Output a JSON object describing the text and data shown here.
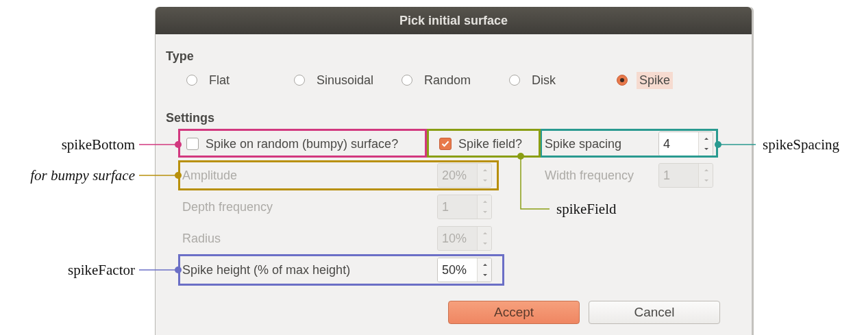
{
  "window": {
    "title": "Pick initial surface"
  },
  "type_group": {
    "heading": "Type",
    "options": [
      {
        "label": "Flat",
        "selected": false,
        "focused": false
      },
      {
        "label": "Sinusoidal",
        "selected": false,
        "focused": false
      },
      {
        "label": "Random",
        "selected": false,
        "focused": false
      },
      {
        "label": "Disk",
        "selected": false,
        "focused": false
      },
      {
        "label": "Spike",
        "selected": true,
        "focused": true
      }
    ]
  },
  "settings": {
    "heading": "Settings",
    "rows": [
      {
        "items": [
          {
            "kind": "checkbox",
            "label": "Spike on random (bumpy) surface?",
            "checked": false
          },
          {
            "kind": "checkbox",
            "label": "Spike field?",
            "checked": true
          },
          {
            "kind": "spinner",
            "label": "Spike spacing",
            "value": "4",
            "disabled": false
          }
        ]
      },
      {
        "items": [
          {
            "kind": "spinner",
            "label": "Amplitude",
            "value": "20%",
            "disabled": true
          },
          {
            "kind": "spinner",
            "label": "Width frequency",
            "value": "1",
            "disabled": true
          }
        ]
      },
      {
        "items": [
          {
            "kind": "spinner",
            "label": "Depth frequency",
            "value": "1",
            "disabled": true
          }
        ]
      },
      {
        "items": [
          {
            "kind": "spinner",
            "label": "Radius",
            "value": "10%",
            "disabled": true
          }
        ]
      },
      {
        "items": [
          {
            "kind": "spinner",
            "label": "Spike height (% of max height)",
            "value": "50%",
            "disabled": false
          }
        ]
      }
    ]
  },
  "buttons": [
    {
      "label": "Accept",
      "kind": "primary"
    },
    {
      "label": "Cancel",
      "kind": "secondary"
    }
  ],
  "annotations": [
    {
      "label": "spikeBottom",
      "kind": "name",
      "color": "#d2387f"
    },
    {
      "label": "spikeSpacing",
      "kind": "name",
      "color": "#2a9a90"
    },
    {
      "label": "for bumpy surface",
      "kind": "note",
      "color": "#b8900c"
    },
    {
      "label": "spikeField",
      "kind": "name",
      "color": "#8a9e14"
    },
    {
      "label": "spikeFactor",
      "kind": "name",
      "color": "#6b6fc6"
    }
  ]
}
